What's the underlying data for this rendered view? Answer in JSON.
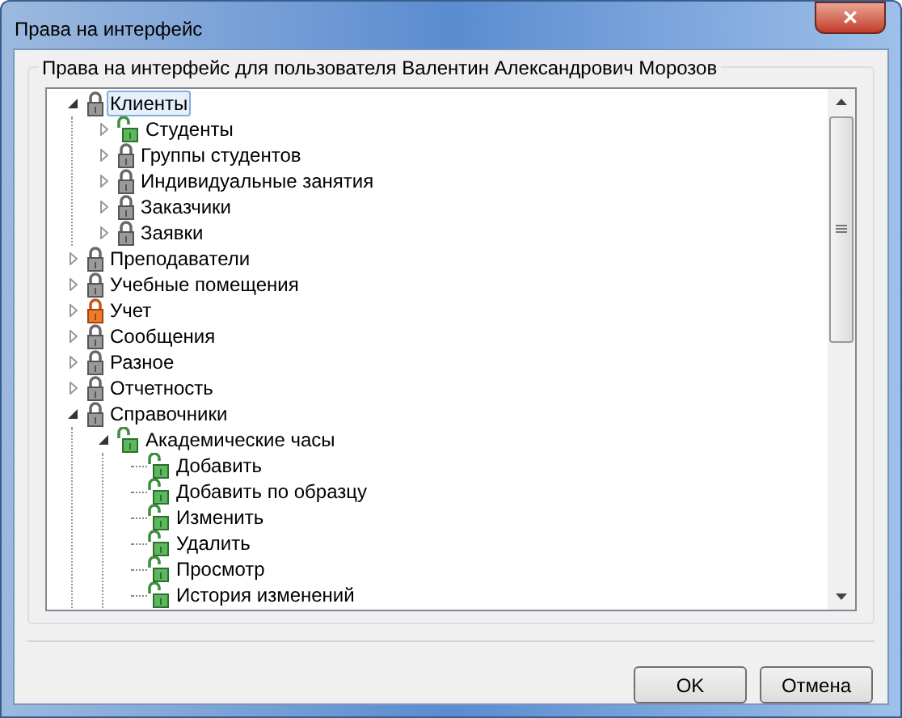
{
  "window": {
    "title": "Права на интерфейс",
    "close": "✕"
  },
  "group": {
    "caption": "Права на интерфейс для пользователя Валентин Александрович Морозов"
  },
  "tree": [
    {
      "label": "Клиенты",
      "kind": "locked",
      "selected": true,
      "expanded": true,
      "children": [
        {
          "label": "Студенты",
          "kind": "unlocked",
          "selected": false,
          "expanded": false
        },
        {
          "label": "Группы студентов",
          "kind": "locked",
          "selected": false,
          "expanded": false
        },
        {
          "label": "Индивидуальные занятия",
          "kind": "locked",
          "selected": false,
          "expanded": false
        },
        {
          "label": "Заказчики",
          "kind": "locked",
          "selected": false,
          "expanded": false
        },
        {
          "label": "Заявки",
          "kind": "locked",
          "selected": false,
          "expanded": false
        }
      ]
    },
    {
      "label": "Преподаватели",
      "kind": "locked",
      "selected": false,
      "expanded": false
    },
    {
      "label": "Учебные помещения",
      "kind": "locked",
      "selected": false,
      "expanded": false
    },
    {
      "label": "Учет",
      "kind": "warning",
      "selected": false,
      "expanded": false
    },
    {
      "label": "Сообщения",
      "kind": "locked",
      "selected": false,
      "expanded": false
    },
    {
      "label": "Разное",
      "kind": "locked",
      "selected": false,
      "expanded": false
    },
    {
      "label": "Отчетность",
      "kind": "locked",
      "selected": false,
      "expanded": false
    },
    {
      "label": "Справочники",
      "kind": "locked",
      "selected": false,
      "expanded": true,
      "children": [
        {
          "label": "Академические часы",
          "kind": "unlocked",
          "selected": false,
          "expanded": true,
          "children": [
            {
              "label": "Добавить",
              "kind": "unlocked",
              "selected": false
            },
            {
              "label": "Добавить по образцу",
              "kind": "unlocked",
              "selected": false
            },
            {
              "label": "Изменить",
              "kind": "unlocked",
              "selected": false
            },
            {
              "label": "Удалить",
              "kind": "unlocked",
              "selected": false
            },
            {
              "label": "Просмотр",
              "kind": "unlocked",
              "selected": false
            },
            {
              "label": "История изменений",
              "kind": "unlocked",
              "selected": false
            }
          ]
        }
      ]
    }
  ],
  "buttons": [
    "OK",
    "Отмена"
  ]
}
